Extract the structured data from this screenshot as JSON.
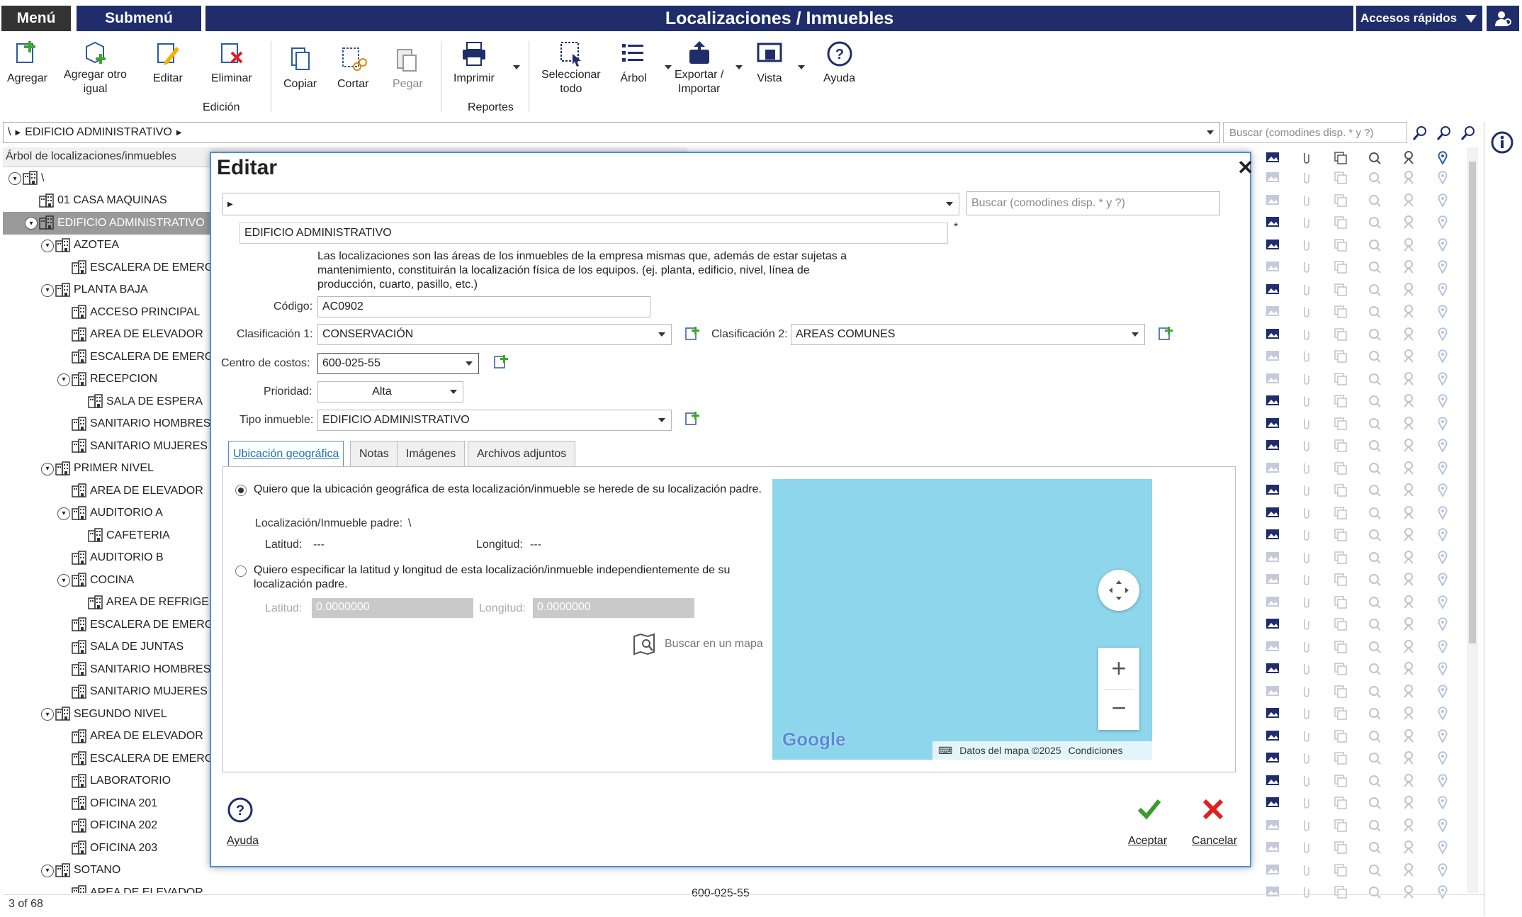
{
  "topbar": {
    "menu": "Menú",
    "submenu": "Submenú",
    "title": "Localizaciones / Inmuebles",
    "quick": "Accesos rápidos"
  },
  "toolbar": {
    "add": "Agregar",
    "add_same_1": "Agregar otro",
    "add_same_2": "igual",
    "edit": "Editar",
    "delete": "Eliminar",
    "copy": "Copiar",
    "cut": "Cortar",
    "paste": "Pegar",
    "print": "Imprimir",
    "select_all_1": "Seleccionar",
    "select_all_2": "todo",
    "tree": "Árbol",
    "export_1": "Exportar /",
    "export_2": "Importar",
    "view": "Vista",
    "help": "Ayuda",
    "group_edit": "Edición",
    "group_reports": "Reportes"
  },
  "path": {
    "root": "\\",
    "item": "EDIFICIO ADMINISTRATIVO"
  },
  "search": {
    "placeholder": "Buscar (comodines disp. * y ?)"
  },
  "tree": {
    "header": "Árbol de localizaciones/inmuebles",
    "rows": [
      {
        "label": "\\",
        "level": 0,
        "exp": true
      },
      {
        "label": "01 CASA MAQUINAS",
        "level": 1
      },
      {
        "label": "EDIFICIO ADMINISTRATIVO",
        "level": 1,
        "exp": true,
        "sel": true
      },
      {
        "label": "AZOTEA",
        "level": 2,
        "exp": true
      },
      {
        "label": "ESCALERA DE EMERGENCIA",
        "level": 3
      },
      {
        "label": "PLANTA BAJA",
        "level": 2,
        "exp": true
      },
      {
        "label": "ACCESO PRINCIPAL",
        "level": 3
      },
      {
        "label": "AREA DE ELEVADOR",
        "level": 3
      },
      {
        "label": "ESCALERA DE EMERGENCIA",
        "level": 3
      },
      {
        "label": "RECEPCION",
        "level": 3,
        "exp": true
      },
      {
        "label": "SALA DE ESPERA",
        "level": 4
      },
      {
        "label": "SANITARIO HOMBRES",
        "level": 3
      },
      {
        "label": "SANITARIO MUJERES",
        "level": 3
      },
      {
        "label": "PRIMER NIVEL",
        "level": 2,
        "exp": true
      },
      {
        "label": "AREA DE ELEVADOR",
        "level": 3
      },
      {
        "label": "AUDITORIO A",
        "level": 3,
        "exp": true
      },
      {
        "label": "CAFETERIA",
        "level": 4
      },
      {
        "label": "AUDITORIO B",
        "level": 3
      },
      {
        "label": "COCINA",
        "level": 3,
        "exp": true
      },
      {
        "label": "AREA DE REFRIGERACION",
        "level": 4
      },
      {
        "label": "ESCALERA DE EMERGENCIA",
        "level": 3
      },
      {
        "label": "SALA DE JUNTAS",
        "level": 3
      },
      {
        "label": "SANITARIO HOMBRES",
        "level": 3
      },
      {
        "label": "SANITARIO MUJERES",
        "level": 3
      },
      {
        "label": "SEGUNDO NIVEL",
        "level": 2,
        "exp": true
      },
      {
        "label": "AREA DE ELEVADOR",
        "level": 3
      },
      {
        "label": "ESCALERA DE EMERGENCIA",
        "level": 3
      },
      {
        "label": "LABORATORIO",
        "level": 3
      },
      {
        "label": "OFICINA 201",
        "level": 3
      },
      {
        "label": "OFICINA 202",
        "level": 3
      },
      {
        "label": "OFICINA 203",
        "level": 3
      },
      {
        "label": "SOTANO",
        "level": 2,
        "exp": true
      },
      {
        "label": "AREA DE ELEVADOR",
        "level": 3
      }
    ],
    "partial_code": "600-025-55"
  },
  "status": {
    "count": "3 of 68"
  },
  "dialog": {
    "title": "Editar",
    "search_placeholder": "Buscar (comodines disp. * y ?)",
    "name": "EDIFICIO ADMINISTRATIVO",
    "required_mark": "*",
    "description": "Las localizaciones son las áreas de los inmuebles de la empresa mismas que, además de estar sujetas a mantenimiento, constituirán la localización física de los equipos. (ej. planta, edificio, nivel, línea de producción, cuarto, pasillo, etc.)",
    "code_label": "Código:",
    "code": "AC0902",
    "class1_label": "Clasificación 1:",
    "class1": "CONSERVACIÓN",
    "class2_label": "Clasificación 2:",
    "class2": "AREAS COMUNES",
    "cost_label": "Centro de costos:",
    "cost": "600-025-55",
    "priority_label": "Prioridad:",
    "priority": "Alta",
    "type_label": "Tipo inmueble:",
    "type": "EDIFICIO ADMINISTRATIVO",
    "tabs": [
      "Ubicación geográfica",
      "Notas",
      "Imágenes",
      "Archivos adjuntos"
    ],
    "radio1": "Quiero que la ubicación geográfica de esta localización/inmueble se herede de su localización padre.",
    "parent_label": "Localización/Inmueble padre:",
    "parent": "\\",
    "lat_label": "Latitud:",
    "lat_val": "---",
    "lon_label": "Longitud:",
    "lon_val": "---",
    "radio2_a": "Quiero especificar la latitud y longitud de esta localización/inmueble independientemente de su",
    "radio2_b": "localización padre.",
    "lat2_label": "Latitud:",
    "lat2": "0.0000000",
    "lon2_label": "Longitud:",
    "lon2": "0.0000000",
    "find_map": "Buscar en un mapa",
    "map_brand": "Google",
    "map_data": "Datos del mapa ©2025",
    "map_terms": "Condiciones",
    "help": "Ayuda",
    "accept": "Aceptar",
    "cancel": "Cancelar"
  },
  "colors": {
    "navy": "#1f2d6b",
    "accent": "#1a6fb5",
    "ok": "#3a9a2a",
    "cancel": "#e02020",
    "map": "#8dd6ec"
  }
}
